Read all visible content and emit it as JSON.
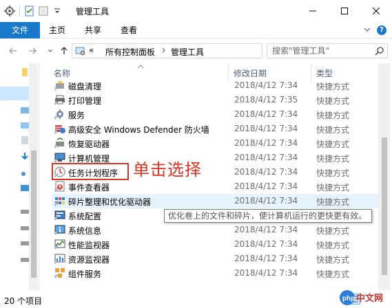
{
  "window": {
    "title": "管理工具"
  },
  "ribbon": {
    "tabs": [
      "文件",
      "主页",
      "共享",
      "查看"
    ]
  },
  "address": {
    "prefix": "«",
    "crumbs": [
      "所有控制面板",
      "管理工具"
    ]
  },
  "search": {
    "placeholder": "搜索\"管理工具\""
  },
  "columns": {
    "name": "名称",
    "date": "修改日期",
    "type": "类型"
  },
  "files": [
    {
      "name": "磁盘清理",
      "date": "2018/4/12 7:34",
      "type": "快捷方式",
      "icon": "disk-cleanup-icon"
    },
    {
      "name": "打印管理",
      "date": "2018/4/12 7:35",
      "type": "快捷方式",
      "icon": "printer-icon"
    },
    {
      "name": "服务",
      "date": "2018/4/12 7:34",
      "type": "快捷方式",
      "icon": "services-gear-icon"
    },
    {
      "name": "高级安全 Windows Defender 防火墙",
      "date": "2018/4/12 7:34",
      "type": "快捷方式",
      "icon": "firewall-icon"
    },
    {
      "name": "恢复驱动器",
      "date": "2018/4/12 7:34",
      "type": "快捷方式",
      "icon": "recovery-drive-icon"
    },
    {
      "name": "计算机管理",
      "date": "2018/4/12 7:34",
      "type": "快捷方式",
      "icon": "computer-management-icon"
    },
    {
      "name": "任务计划程序",
      "date": "2018/4/12 7:34",
      "type": "快捷方式",
      "icon": "task-scheduler-clock-icon"
    },
    {
      "name": "事件查看器",
      "date": "2018/4/12 7:34",
      "type": "快捷方式",
      "icon": "event-viewer-icon"
    },
    {
      "name": "碎片整理和优化驱动器",
      "date": "2018/4/12 7:34",
      "type": "快捷方式",
      "icon": "defrag-icon"
    },
    {
      "name": "系统配置",
      "date": "2018/4/12 7:34",
      "type": "快捷方式",
      "icon": "system-config-icon"
    },
    {
      "name": "系统信息",
      "date": "2018/4/12 7:34",
      "type": "快捷方式",
      "icon": "system-info-icon"
    },
    {
      "name": "性能监视器",
      "date": "2018/4/12 7:34",
      "type": "快捷方式",
      "icon": "performance-monitor-icon"
    },
    {
      "name": "资源监视器",
      "date": "2018/4/12 7:34",
      "type": "快捷方式",
      "icon": "resource-monitor-icon"
    },
    {
      "name": "组件服务",
      "date": "2018/4/12 7:34",
      "type": "快捷方式",
      "icon": "component-services-icon"
    }
  ],
  "annotation": {
    "text": "单击选择",
    "color": "#e0301e"
  },
  "tooltip": {
    "text": "优化卷上的文件和碎片，使计算机运行的更快更有效。"
  },
  "status": {
    "count": "20 个项目"
  },
  "colors": {
    "accent": "#1979ca",
    "hover": "#e5f3ff",
    "callout": "#e0301e"
  }
}
